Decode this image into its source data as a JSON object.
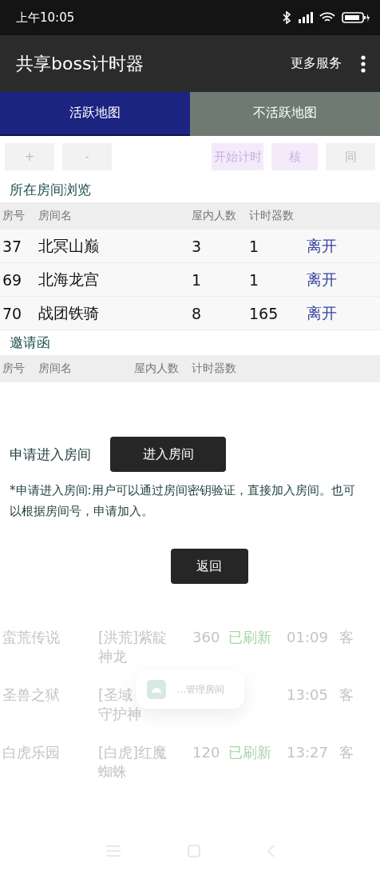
{
  "status_bar": {
    "time": "上午10:05"
  },
  "app_bar": {
    "title": "共享boss计时器",
    "action": "更多服务"
  },
  "tabs": [
    {
      "label": "活跃地图",
      "selected": true
    },
    {
      "label": "不活跃地图",
      "selected": false
    }
  ],
  "toolbar": {
    "buttons": [
      {
        "label": "+",
        "kind": "plain"
      },
      {
        "label": "-",
        "kind": "plain"
      },
      {
        "label": "开始计时",
        "kind": "accent"
      },
      {
        "label": "核",
        "kind": "accent"
      },
      {
        "label": "同",
        "kind": "plain"
      }
    ]
  },
  "dialog": {
    "rooms_title": "所在房间浏览",
    "rooms_columns": [
      "房号",
      "房间名",
      "屋内人数",
      "计时器数"
    ],
    "rooms": [
      {
        "number": "37",
        "name": "北冥山巅",
        "people": "3",
        "timers": "1",
        "action": "离开"
      },
      {
        "number": "69",
        "name": "北海龙宫",
        "people": "1",
        "timers": "1",
        "action": "离开"
      },
      {
        "number": "70",
        "name": "战团铁骑",
        "people": "8",
        "timers": "165",
        "action": "离开"
      }
    ],
    "invites_title": "邀请函",
    "invites_columns": [
      "房号",
      "房间名",
      "屋内人数",
      "计时器数"
    ],
    "apply_label": "申请进入房间",
    "apply_button": "进入房间",
    "note": "*申请进入房间:用户可以通过房间密钥验证，直接加入房间。也可以根据房间号，申请加入。",
    "back_button": "返回"
  },
  "background_rows": [
    {
      "map": "蛮荒传说",
      "boss": [
        "[洪荒]紫靛",
        "神龙"
      ],
      "level": "360",
      "status": "已刷新",
      "time": "01:09",
      "mark": "客"
    },
    {
      "map": "圣兽之狱",
      "boss": [
        "[圣域",
        "守护神"
      ],
      "level": "",
      "status": "",
      "time": "13:05",
      "mark": "客"
    },
    {
      "map": "白虎乐园",
      "boss": [
        "[白虎]红魔",
        "蜘蛛"
      ],
      "level": "120",
      "status": "已刷新",
      "time": "13:27",
      "mark": "客"
    }
  ],
  "toast": {
    "text": "...管理房间"
  }
}
